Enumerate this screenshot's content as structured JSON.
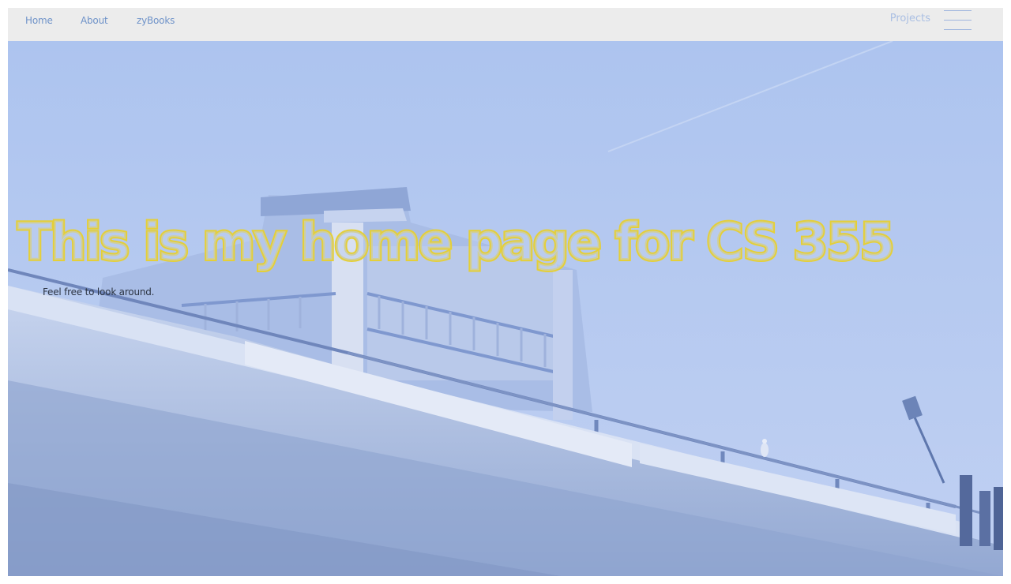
{
  "nav": {
    "links": [
      {
        "label": "Home"
      },
      {
        "label": "About"
      },
      {
        "label": "zyBooks"
      }
    ],
    "projects_label": "Projects",
    "menu_icon": "hamburger-menu-icon"
  },
  "hero": {
    "title": "This is my home page for CS 355",
    "subtitle": "Feel free to look around.",
    "background_description_icon": "pier-house-photo",
    "overlay_color": "#b4c8ef",
    "title_outline_color": "#e4cf3a"
  }
}
